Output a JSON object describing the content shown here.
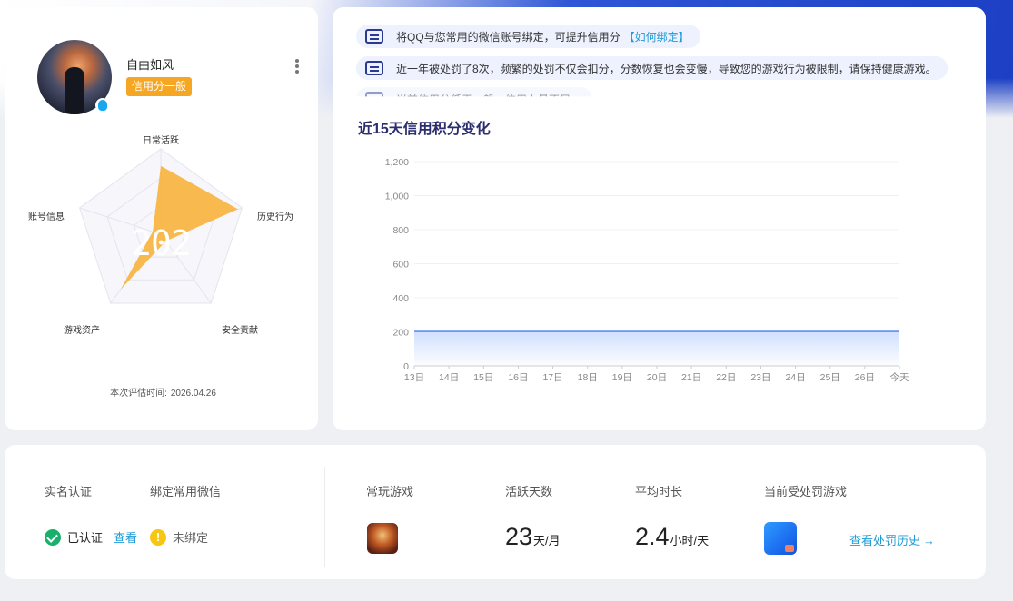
{
  "profile": {
    "username": "自由如风",
    "credit_level": "信用分一般",
    "score": "202",
    "radar_labels": {
      "top": "日常活跃",
      "right": "历史行为",
      "bottom_right": "安全贡献",
      "bottom_left": "游戏资产",
      "left": "账号信息"
    },
    "radar_values": [
      0.8,
      0.95,
      0.1,
      0.8,
      0.1
    ],
    "eval_time_label": "本次评估时间:",
    "eval_time_value": "2026.04.26"
  },
  "notices": [
    {
      "text": "将QQ与您常用的微信账号绑定，可提升信用分",
      "link": "【如何绑定】"
    },
    {
      "text": "近一年被处罚了8次，频繁的处罚不仅会扣分，分数恢复也会变慢，导致您的游戏行为被限制，请保持健康游戏。"
    },
    {
      "text": "当前信用分低于一般，信用力量不足。"
    }
  ],
  "chart_data": {
    "type": "area",
    "title": "近15天信用积分变化",
    "x": [
      "13日",
      "14日",
      "15日",
      "16日",
      "17日",
      "18日",
      "19日",
      "20日",
      "21日",
      "22日",
      "23日",
      "24日",
      "25日",
      "26日",
      "今天"
    ],
    "values": [
      202,
      202,
      202,
      202,
      202,
      202,
      202,
      202,
      202,
      202,
      202,
      202,
      202,
      202,
      202
    ],
    "yticks": [
      "0",
      "200",
      "400",
      "600",
      "800",
      "1,000",
      "1,200"
    ],
    "ylim": [
      0,
      1200
    ],
    "color": "#5b8ff9"
  },
  "stats": {
    "real_name_label": "实名认证",
    "verified_text": "已认证",
    "view_label": "查看",
    "bind_wechat_label": "绑定常用微信",
    "unbound_text": "未绑定",
    "frequent_game_label": "常玩游戏",
    "active_days_label": "活跃天数",
    "active_days_value": "23",
    "active_days_unit": "天/月",
    "avg_time_label": "平均时长",
    "avg_time_value": "2.4",
    "avg_time_unit": "小时/天",
    "punished_game_label": "当前受处罚游戏",
    "history_link": "查看处罚历史",
    "history_arrow": "→"
  }
}
